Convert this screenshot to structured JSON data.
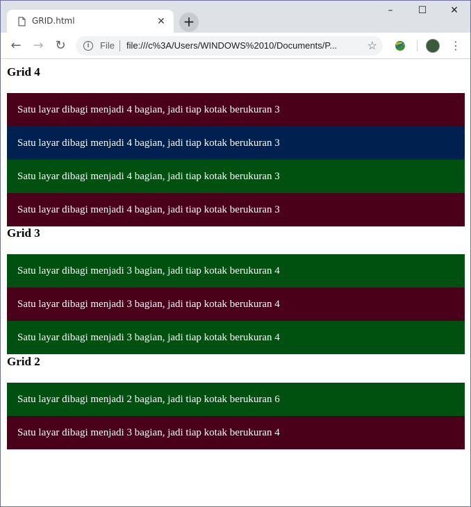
{
  "browser": {
    "tab_title": "GRID.html",
    "new_tab": "+",
    "controls": {
      "minimize": "–",
      "maximize": "☐",
      "close": "✕"
    },
    "address": {
      "scheme": "File",
      "url": "file:///c%3A/Users/WINDOWS%2010/Documents/P..."
    },
    "nav": {
      "back": "←",
      "forward": "→",
      "reload": "↻"
    },
    "menu": "⋮",
    "star": "☆"
  },
  "colors": {
    "maroon": "#4a0019",
    "navy": "#002050",
    "green": "#005010"
  },
  "sections": [
    {
      "heading": "Grid 4",
      "boxes": [
        {
          "text": "Satu layar dibagi menjadi 4 bagian, jadi tiap kotak berukuran 3",
          "color": "maroon"
        },
        {
          "text": "Satu layar dibagi menjadi 4 bagian, jadi tiap kotak berukuran 3",
          "color": "navy"
        },
        {
          "text": "Satu layar dibagi menjadi 4 bagian, jadi tiap kotak berukuran 3",
          "color": "green"
        },
        {
          "text": "Satu layar dibagi menjadi 4 bagian, jadi tiap kotak berukuran 3",
          "color": "maroon"
        }
      ]
    },
    {
      "heading": "Grid 3",
      "boxes": [
        {
          "text": "Satu layar dibagi menjadi 3 bagian, jadi tiap kotak berukuran 4",
          "color": "green"
        },
        {
          "text": "Satu layar dibagi menjadi 3 bagian, jadi tiap kotak berukuran 4",
          "color": "maroon"
        },
        {
          "text": "Satu layar dibagi menjadi 3 bagian, jadi tiap kotak berukuran 4",
          "color": "green"
        }
      ]
    },
    {
      "heading": "Grid 2",
      "boxes": [
        {
          "text": "Satu layar dibagi menjadi 2 bagian, jadi tiap kotak berukuran 6",
          "color": "green"
        },
        {
          "text": "Satu layar dibagi menjadi 3 bagian, jadi tiap kotak berukuran 4",
          "color": "maroon"
        }
      ]
    }
  ]
}
